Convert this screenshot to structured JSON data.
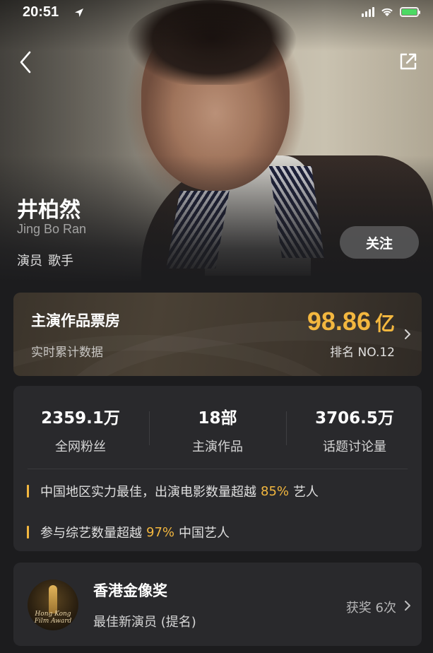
{
  "status": {
    "time": "20:51"
  },
  "profile": {
    "name": "井柏然",
    "name_en": "Jing Bo Ran",
    "roles": [
      "演员",
      "歌手"
    ],
    "follow_label": "关注"
  },
  "box_office": {
    "title": "主演作品票房",
    "subtitle": "实时累计数据",
    "amount": "98.86",
    "unit": "亿",
    "rank": "排名 NO.12"
  },
  "stats": [
    {
      "value": "2359.1万",
      "label": "全网粉丝"
    },
    {
      "value": "18部",
      "label": "主演作品"
    },
    {
      "value": "3706.5万",
      "label": "话题讨论量"
    }
  ],
  "facts": [
    {
      "before": "中国地区实力最佳，出演电影数量超越",
      "highlight": "85%",
      "after": "艺人"
    },
    {
      "before": "参与综艺数量超越",
      "highlight": "97%",
      "after": "中国艺人"
    }
  ],
  "award": {
    "title": "香港金像奖",
    "subtitle": "最佳新演员 (提名)",
    "count": "获奖 6次",
    "logo_text_1": "Hong Kong",
    "logo_text_2": "Film Award"
  },
  "colors": {
    "accent": "#f3b73f",
    "background": "#1c1c1e",
    "card": "#29292c"
  }
}
